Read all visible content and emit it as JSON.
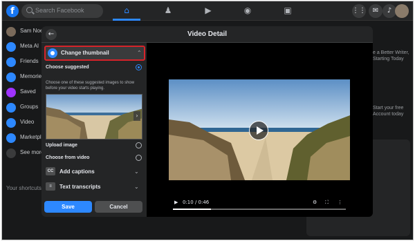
{
  "topbar": {
    "search_placeholder": "Search Facebook",
    "logo_letter": "f"
  },
  "sidebar": {
    "items": [
      {
        "label": "Sam Noe",
        "color": "#7a6a5a"
      },
      {
        "label": "Meta AI",
        "color": "#2d88ff"
      },
      {
        "label": "Friends",
        "color": "#2d88ff"
      },
      {
        "label": "Memories",
        "color": "#2d88ff"
      },
      {
        "label": "Saved",
        "color": "#a033ff"
      },
      {
        "label": "Groups",
        "color": "#2d88ff"
      },
      {
        "label": "Video",
        "color": "#2d88ff"
      },
      {
        "label": "Marketplace",
        "color": "#2d88ff"
      },
      {
        "label": "See more",
        "color": "#3a3b3c"
      }
    ],
    "shortcuts_heading": "Your shortcuts"
  },
  "right_column": {
    "lines_a": [
      "e a Better Writer,",
      "Starting Today"
    ],
    "lines_b": [
      "Start your free",
      "Account today"
    ]
  },
  "dialog": {
    "title": "Video Detail",
    "thumbnail": {
      "heading": "Change thumbnail",
      "choose_suggested": "Choose suggested",
      "help": "Choose one of these suggested images to show before your video starts playing.",
      "upload_image": "Upload image",
      "choose_from_video": "Choose from video"
    },
    "captions": {
      "icon": "CC",
      "label": "Add captions"
    },
    "transcripts": {
      "label": "Text transcripts"
    },
    "buttons": {
      "save": "Save",
      "cancel": "Cancel"
    },
    "player": {
      "time": "0:10 / 0:46",
      "progress_fraction": 0.22
    }
  },
  "colors": {
    "accent": "#2d88ff",
    "highlight_border": "#d6232a",
    "panel_bg": "#242526"
  }
}
